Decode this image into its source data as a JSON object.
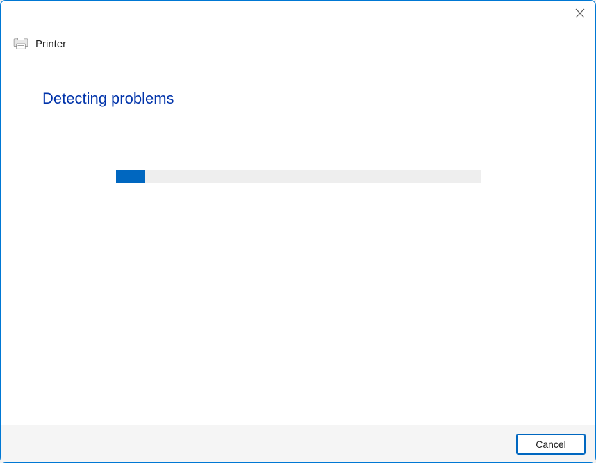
{
  "header": {
    "title": "Printer"
  },
  "main": {
    "heading": "Detecting problems",
    "progress_percent": 8
  },
  "footer": {
    "cancel_label": "Cancel"
  }
}
